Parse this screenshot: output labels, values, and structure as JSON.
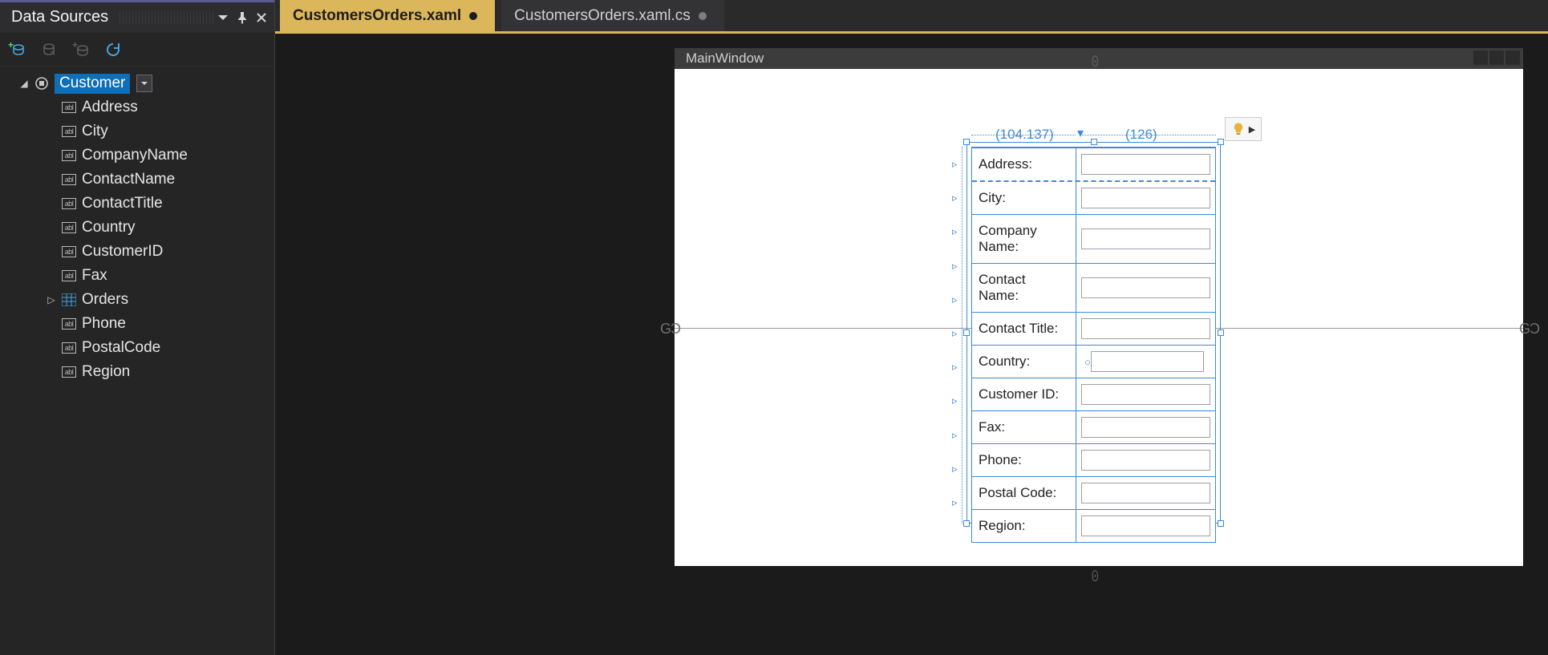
{
  "panel": {
    "title": "Data Sources",
    "toolbar": {
      "add_label": "Add New Data Source",
      "edit_label": "Edit",
      "add_query_label": "Add Query",
      "refresh_label": "Refresh"
    },
    "tree": {
      "root": {
        "label": "Customer",
        "expanded": true,
        "kind": "object"
      },
      "children": [
        {
          "label": "Address",
          "kind": "text"
        },
        {
          "label": "City",
          "kind": "text"
        },
        {
          "label": "CompanyName",
          "kind": "text"
        },
        {
          "label": "ContactName",
          "kind": "text"
        },
        {
          "label": "ContactTitle",
          "kind": "text"
        },
        {
          "label": "Country",
          "kind": "text"
        },
        {
          "label": "CustomerID",
          "kind": "text"
        },
        {
          "label": "Fax",
          "kind": "text"
        },
        {
          "label": "Orders",
          "kind": "collection",
          "expandable": true
        },
        {
          "label": "Phone",
          "kind": "text"
        },
        {
          "label": "PostalCode",
          "kind": "text"
        },
        {
          "label": "Region",
          "kind": "text"
        }
      ]
    }
  },
  "tabs": [
    {
      "label": "CustomersOrders.xaml",
      "dirty": true,
      "active": true
    },
    {
      "label": "CustomersOrders.xaml.cs",
      "dirty": true,
      "active": false
    }
  ],
  "designer": {
    "window_title": "MainWindow",
    "column_widths": {
      "col0": "(104.137)",
      "col1": "(126)"
    },
    "form_rows": [
      {
        "label": "Address:",
        "value": ""
      },
      {
        "label": "City:",
        "value": ""
      },
      {
        "label": "Company Name:",
        "value": ""
      },
      {
        "label": "Contact Name:",
        "value": ""
      },
      {
        "label": "Contact Title:",
        "value": ""
      },
      {
        "label": "Country:",
        "value": ""
      },
      {
        "label": "Customer ID:",
        "value": ""
      },
      {
        "label": "Fax:",
        "value": ""
      },
      {
        "label": "Phone:",
        "value": ""
      },
      {
        "label": "Postal Code:",
        "value": ""
      },
      {
        "label": "Region:",
        "value": ""
      }
    ]
  }
}
